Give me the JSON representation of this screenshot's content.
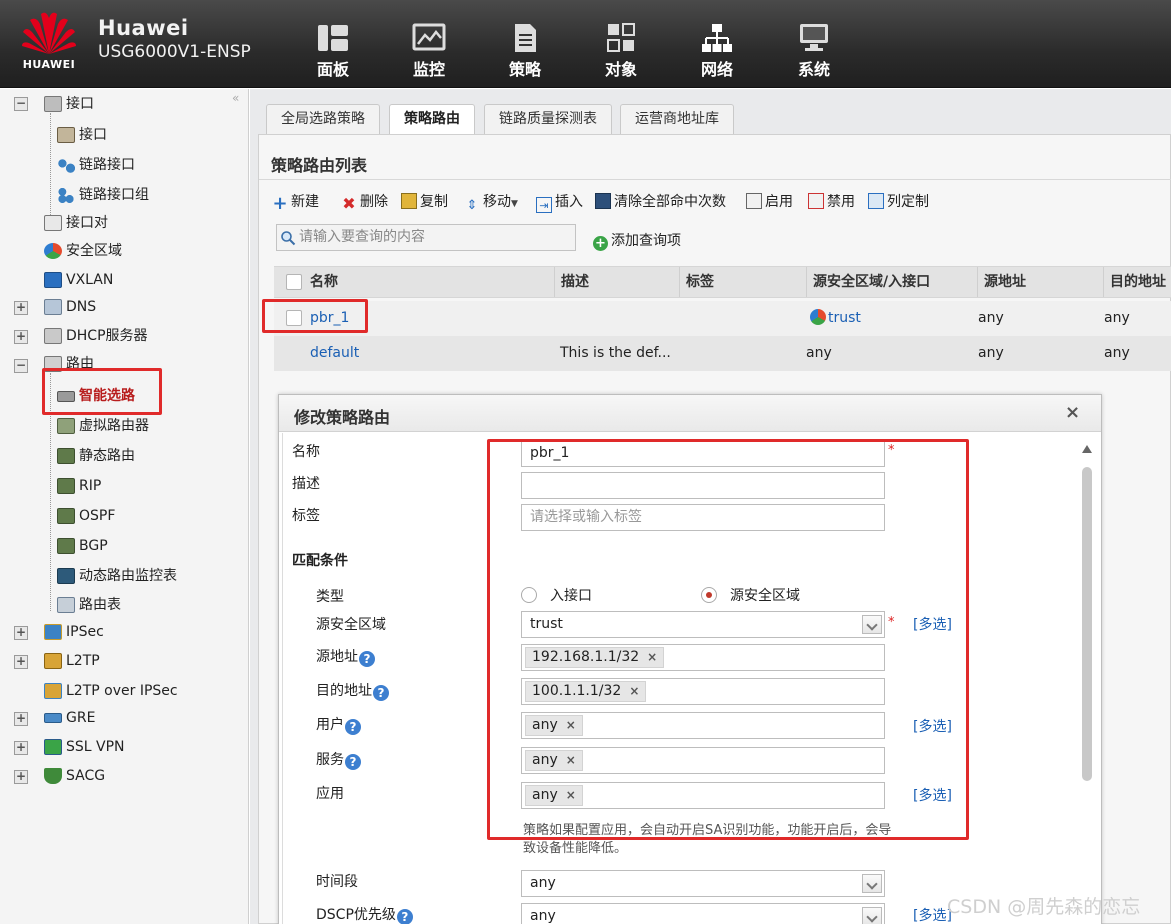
{
  "header": {
    "brand": "Huawei",
    "model": "USG6000V1-ENSP",
    "logo_text": "HUAWEI",
    "nav": [
      {
        "label": "面板",
        "icon": "dashboard-icon"
      },
      {
        "label": "监控",
        "icon": "monitor-icon"
      },
      {
        "label": "策略",
        "icon": "policy-icon"
      },
      {
        "label": "对象",
        "icon": "object-icon"
      },
      {
        "label": "网络",
        "icon": "network-icon"
      },
      {
        "label": "系统",
        "icon": "system-icon"
      }
    ]
  },
  "sidebar": {
    "items": [
      {
        "label": "接口",
        "expander": "−"
      },
      {
        "label": "接口"
      },
      {
        "label": "链路接口"
      },
      {
        "label": "链路接口组"
      },
      {
        "label": "接口对"
      },
      {
        "label": "安全区域"
      },
      {
        "label": "VXLAN"
      },
      {
        "label": "DNS",
        "expander": "+"
      },
      {
        "label": "DHCP服务器",
        "expander": "+"
      },
      {
        "label": "路由",
        "expander": "−"
      },
      {
        "label": "智能选路"
      },
      {
        "label": "虚拟路由器"
      },
      {
        "label": "静态路由"
      },
      {
        "label": "RIP"
      },
      {
        "label": "OSPF"
      },
      {
        "label": "BGP"
      },
      {
        "label": "动态路由监控表"
      },
      {
        "label": "路由表"
      },
      {
        "label": "IPSec",
        "expander": "+"
      },
      {
        "label": "L2TP",
        "expander": "+"
      },
      {
        "label": "L2TP over IPSec"
      },
      {
        "label": "GRE",
        "expander": "+"
      },
      {
        "label": "SSL VPN",
        "expander": "+"
      },
      {
        "label": "SACG",
        "expander": "+"
      }
    ],
    "collapse_glyph": "«"
  },
  "tabs": [
    "全局选路策略",
    "策略路由",
    "链路质量探测表",
    "运营商地址库"
  ],
  "panel": {
    "title": "策略路由列表",
    "toolbar": [
      "新建",
      "删除",
      "复制",
      "移动",
      "插入",
      "清除全部命中次数",
      "启用",
      "禁用",
      "列定制"
    ],
    "search_placeholder": "请输入要查询的内容",
    "add_query": "添加查询项"
  },
  "table": {
    "headers": [
      "名称",
      "描述",
      "标签",
      "源安全区域/入接口",
      "源地址",
      "目的地址"
    ],
    "rows": [
      {
        "name": "pbr_1",
        "desc": "",
        "tag": "",
        "zone": "trust",
        "src": "any",
        "dst": "any"
      },
      {
        "name": "default",
        "desc": "This is the def...",
        "tag": "",
        "zone": "any",
        "src": "any",
        "dst": "any"
      }
    ]
  },
  "dialog": {
    "title": "修改策略路由",
    "close": "×",
    "name_label": "名称",
    "name_value": "pbr_1",
    "desc_label": "描述",
    "desc_value": "",
    "tag_label": "标签",
    "tag_placeholder": "请选择或输入标签",
    "match_title": "匹配条件",
    "type_label": "类型",
    "type_options": [
      "入接口",
      "源安全区域"
    ],
    "type_selected": "源安全区域",
    "zone_label": "源安全区域",
    "zone_value": "trust",
    "src_label": "源地址",
    "src_value": "192.168.1.1/32",
    "dst_label": "目的地址",
    "dst_value": "100.1.1.1/32",
    "user_label": "用户",
    "user_value": "any",
    "service_label": "服务",
    "service_value": "any",
    "app_label": "应用",
    "app_value": "any",
    "app_note": "策略如果配置应用，会自动开启SA识别功能，功能开启后，会导致设备性能降低。",
    "time_label": "时间段",
    "time_value": "any",
    "dscp_label": "DSCP优先级",
    "dscp_value": "any",
    "multi_select": "[多选]",
    "required": "*",
    "help": "?",
    "chip_remove": "×"
  },
  "watermark": "CSDN @周先森的恋忘",
  "colors": {
    "header_bg": "#2b2b2b",
    "link": "#1a5fb4",
    "highlight": "#e02a2a",
    "huawei_red": "#d7000f"
  }
}
